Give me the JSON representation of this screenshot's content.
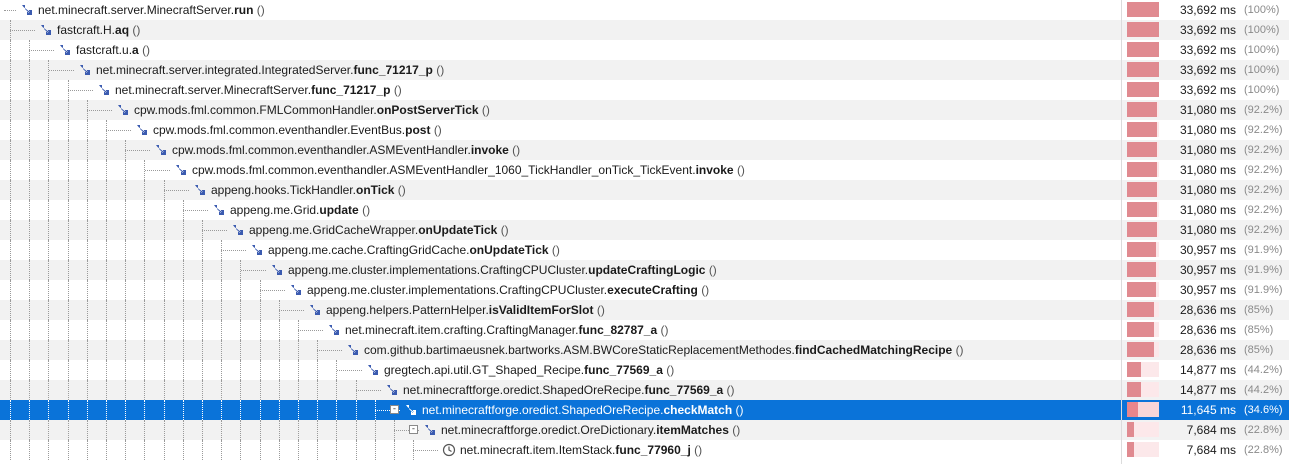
{
  "colors": {
    "selection": "#0a73d9",
    "bar_fill": "#e08a90",
    "bar_track": "#fce8ea",
    "method_icon": "#3b5bb0"
  },
  "rows": [
    {
      "depth": 0,
      "pkg": "net.minecraft.server.MinecraftServer.",
      "method": "run",
      "args": "()",
      "time": "33,692 ms",
      "pct": "(100%)",
      "fraction": 1.0,
      "icon": "method-icon"
    },
    {
      "depth": 1,
      "pkg": "fastcraft.H.",
      "method": "aq",
      "args": "()",
      "time": "33,692 ms",
      "pct": "(100%)",
      "fraction": 1.0,
      "icon": "method-icon"
    },
    {
      "depth": 2,
      "pkg": "fastcraft.u.",
      "method": "a",
      "args": "()",
      "time": "33,692 ms",
      "pct": "(100%)",
      "fraction": 1.0,
      "icon": "method-icon"
    },
    {
      "depth": 3,
      "pkg": "net.minecraft.server.integrated.IntegratedServer.",
      "method": "func_71217_p",
      "args": "()",
      "time": "33,692 ms",
      "pct": "(100%)",
      "fraction": 1.0,
      "icon": "method-icon"
    },
    {
      "depth": 4,
      "pkg": "net.minecraft.server.MinecraftServer.",
      "method": "func_71217_p",
      "args": "()",
      "time": "33,692 ms",
      "pct": "(100%)",
      "fraction": 1.0,
      "icon": "method-icon"
    },
    {
      "depth": 5,
      "pkg": "cpw.mods.fml.common.FMLCommonHandler.",
      "method": "onPostServerTick",
      "args": "()",
      "time": "31,080 ms",
      "pct": "(92.2%)",
      "fraction": 0.922,
      "icon": "method-icon"
    },
    {
      "depth": 6,
      "pkg": "cpw.mods.fml.common.eventhandler.EventBus.",
      "method": "post",
      "args": "()",
      "time": "31,080 ms",
      "pct": "(92.2%)",
      "fraction": 0.922,
      "icon": "method-icon"
    },
    {
      "depth": 7,
      "pkg": "cpw.mods.fml.common.eventhandler.ASMEventHandler.",
      "method": "invoke",
      "args": "()",
      "time": "31,080 ms",
      "pct": "(92.2%)",
      "fraction": 0.922,
      "icon": "method-icon"
    },
    {
      "depth": 8,
      "pkg": "cpw.mods.fml.common.eventhandler.ASMEventHandler_1060_TickHandler_onTick_TickEvent.",
      "method": "invoke",
      "args": "()",
      "time": "31,080 ms",
      "pct": "(92.2%)",
      "fraction": 0.922,
      "icon": "method-icon"
    },
    {
      "depth": 9,
      "pkg": "appeng.hooks.TickHandler.",
      "method": "onTick",
      "args": "()",
      "time": "31,080 ms",
      "pct": "(92.2%)",
      "fraction": 0.922,
      "icon": "method-icon"
    },
    {
      "depth": 10,
      "pkg": "appeng.me.Grid.",
      "method": "update",
      "args": "()",
      "time": "31,080 ms",
      "pct": "(92.2%)",
      "fraction": 0.922,
      "icon": "method-icon"
    },
    {
      "depth": 11,
      "pkg": "appeng.me.GridCacheWrapper.",
      "method": "onUpdateTick",
      "args": "()",
      "time": "31,080 ms",
      "pct": "(92.2%)",
      "fraction": 0.922,
      "icon": "method-icon"
    },
    {
      "depth": 12,
      "pkg": "appeng.me.cache.CraftingGridCache.",
      "method": "onUpdateTick",
      "args": "()",
      "time": "30,957 ms",
      "pct": "(91.9%)",
      "fraction": 0.919,
      "icon": "method-icon"
    },
    {
      "depth": 13,
      "pkg": "appeng.me.cluster.implementations.CraftingCPUCluster.",
      "method": "updateCraftingLogic",
      "args": "()",
      "time": "30,957 ms",
      "pct": "(91.9%)",
      "fraction": 0.919,
      "icon": "method-icon"
    },
    {
      "depth": 14,
      "pkg": "appeng.me.cluster.implementations.CraftingCPUCluster.",
      "method": "executeCrafting",
      "args": "()",
      "time": "30,957 ms",
      "pct": "(91.9%)",
      "fraction": 0.919,
      "icon": "method-icon"
    },
    {
      "depth": 15,
      "pkg": "appeng.helpers.PatternHelper.",
      "method": "isValidItemForSlot",
      "args": "()",
      "time": "28,636 ms",
      "pct": "(85%)",
      "fraction": 0.85,
      "icon": "method-icon"
    },
    {
      "depth": 16,
      "pkg": "net.minecraft.item.crafting.CraftingManager.",
      "method": "func_82787_a",
      "args": "()",
      "time": "28,636 ms",
      "pct": "(85%)",
      "fraction": 0.85,
      "icon": "method-icon"
    },
    {
      "depth": 17,
      "pkg": "com.github.bartimaeusnek.bartworks.ASM.BWCoreStaticReplacementMethodes.",
      "method": "findCachedMatchingRecipe",
      "args": "()",
      "time": "28,636 ms",
      "pct": "(85%)",
      "fraction": 0.85,
      "icon": "method-icon"
    },
    {
      "depth": 18,
      "pkg": "gregtech.api.util.GT_Shaped_Recipe.",
      "method": "func_77569_a",
      "args": "()",
      "time": "14,877 ms",
      "pct": "(44.2%)",
      "fraction": 0.442,
      "icon": "method-icon"
    },
    {
      "depth": 19,
      "pkg": "net.minecraftforge.oredict.ShapedOreRecipe.",
      "method": "func_77569_a",
      "args": "()",
      "time": "14,877 ms",
      "pct": "(44.2%)",
      "fraction": 0.442,
      "icon": "method-icon"
    },
    {
      "depth": 20,
      "pkg": "net.minecraftforge.oredict.ShapedOreRecipe.",
      "method": "checkMatch",
      "args": "()",
      "time": "11,645 ms",
      "pct": "(34.6%)",
      "fraction": 0.346,
      "icon": "method-icon",
      "selected": true,
      "expander": "-"
    },
    {
      "depth": 21,
      "pkg": "net.minecraftforge.oredict.OreDictionary.",
      "method": "itemMatches",
      "args": "()",
      "time": "7,684 ms",
      "pct": "(22.8%)",
      "fraction": 0.228,
      "icon": "method-icon",
      "expander": "-"
    },
    {
      "depth": 22,
      "pkg": "net.minecraft.item.ItemStack.",
      "method": "func_77960_j",
      "args": "()",
      "time": "7,684 ms",
      "pct": "(22.8%)",
      "fraction": 0.228,
      "icon": "clock-icon"
    }
  ]
}
